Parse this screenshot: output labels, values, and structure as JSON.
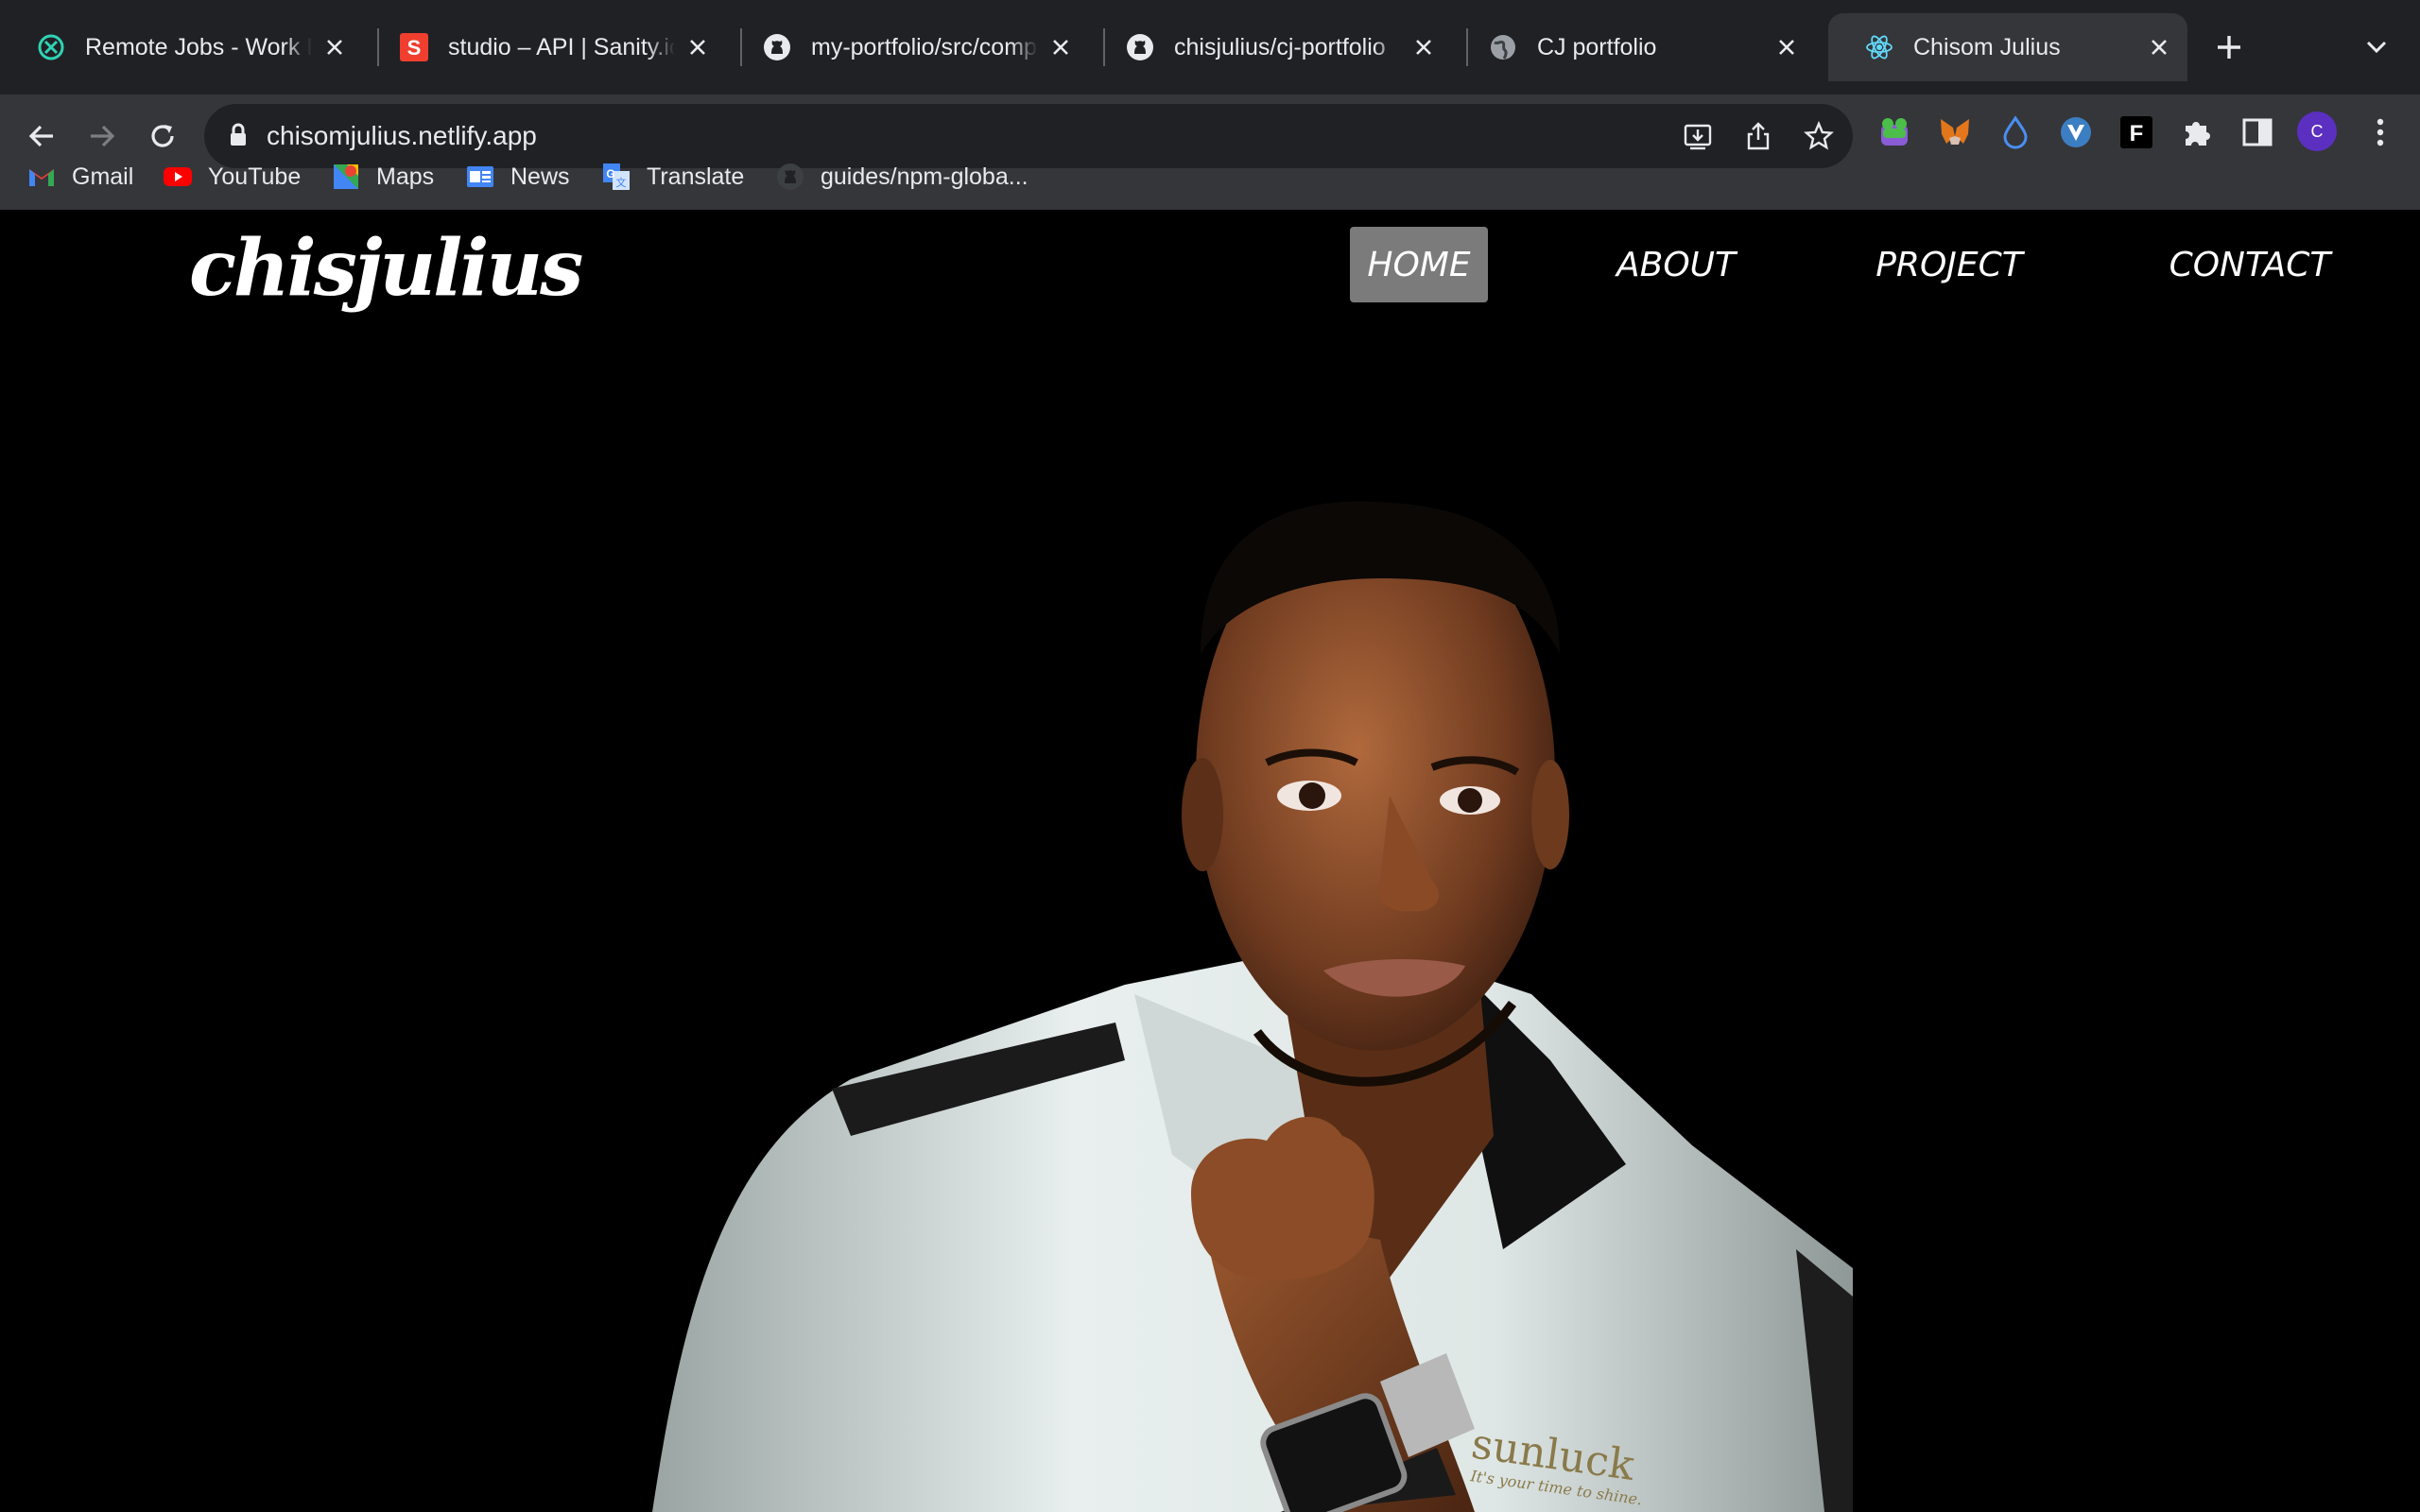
{
  "tabs": [
    {
      "title": "Remote Jobs - Work From Home",
      "favicon": "remote-jobs-icon",
      "active": false
    },
    {
      "title": "studio – API | Sanity.io",
      "favicon": "sanity-icon",
      "active": false
    },
    {
      "title": "my-portfolio/src/components",
      "favicon": "github-icon",
      "active": false
    },
    {
      "title": "chisjulius/cj-portfolio",
      "favicon": "github-icon",
      "active": false
    },
    {
      "title": "CJ portfolio",
      "favicon": "globe-icon",
      "active": false
    },
    {
      "title": "Chisom Julius",
      "favicon": "react-icon",
      "active": true
    }
  ],
  "address_bar": {
    "url": "chisomjulius.netlify.app"
  },
  "profile": {
    "initial": "C",
    "color": "#5b2fbf"
  },
  "bookmarks": [
    {
      "label": "Gmail",
      "icon": "gmail-icon"
    },
    {
      "label": "YouTube",
      "icon": "youtube-icon"
    },
    {
      "label": "Maps",
      "icon": "maps-icon"
    },
    {
      "label": "News",
      "icon": "news-icon"
    },
    {
      "label": "Translate",
      "icon": "translate-icon"
    },
    {
      "label": "guides/npm-globa...",
      "icon": "github-icon"
    }
  ],
  "site": {
    "logo": "chisjulius",
    "nav": [
      {
        "label": "HOME",
        "active": true
      },
      {
        "label": "ABOUT",
        "active": false
      },
      {
        "label": "PROJECT",
        "active": false
      },
      {
        "label": "CONTACT",
        "active": false
      }
    ],
    "shirt_brand": "sunluck",
    "shirt_slogan": "It's your time to shine."
  },
  "colors": {
    "tabstrip_bg": "#202124",
    "toolbar_bg": "#35363a",
    "nav_active_bg": "#7b7b7b",
    "page_bg": "#000000"
  }
}
